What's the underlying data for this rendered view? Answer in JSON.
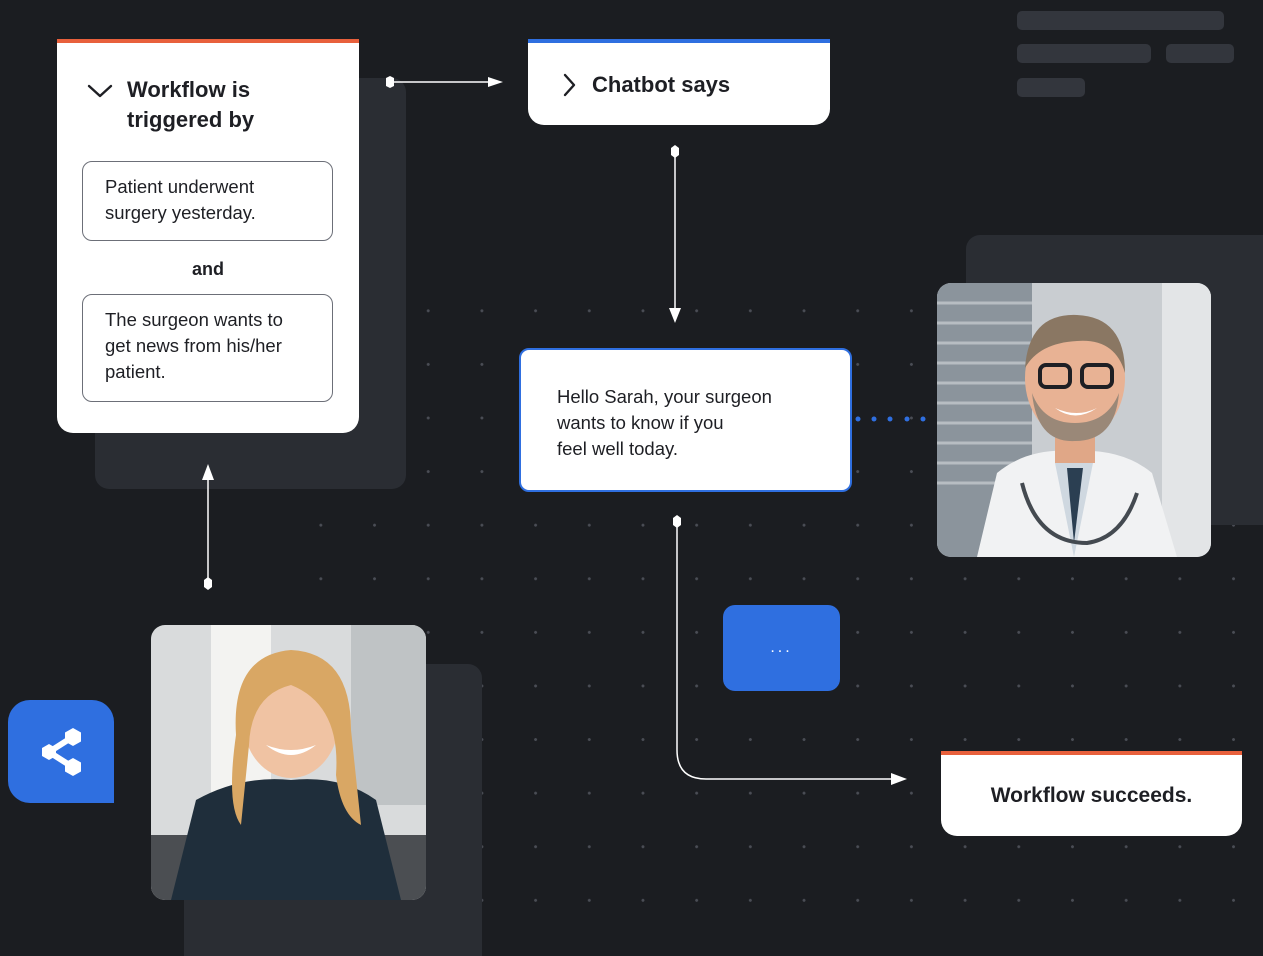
{
  "trigger_card": {
    "title_line1": "Workflow is",
    "title_line2": "triggered by",
    "condition_1": "Patient underwent surgery yesterday.",
    "connector": "and",
    "condition_2": "The surgeon wants to get news from his/her patient."
  },
  "chatbot_card": {
    "title": "Chatbot says"
  },
  "message": {
    "line1": "Hello Sarah, your surgeon",
    "line2": "wants to know if you",
    "line3": "feel well today."
  },
  "typing_indicator": "...",
  "result_card": {
    "label": "Workflow succeeds."
  },
  "colors": {
    "accent_blue": "#2f6fe0",
    "accent_orange": "#e8603c",
    "background": "#1b1d21"
  },
  "icons": [
    "chevron-down-icon",
    "chevron-right-icon",
    "share-nodes-icon"
  ]
}
